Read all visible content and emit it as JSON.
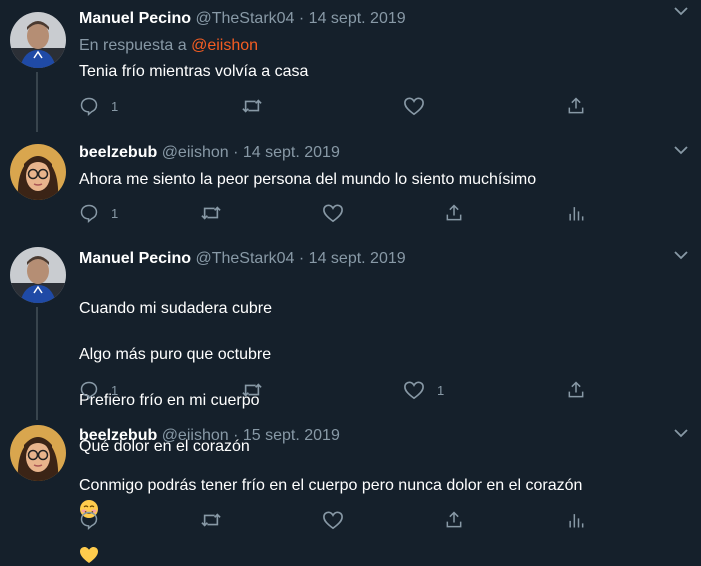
{
  "tweets": [
    {
      "name": "Manuel Pecino",
      "handle": "@TheStark04",
      "date": "14 sept. 2019",
      "reply_prefix": "En respuesta a",
      "reply_handle": "@eiishon",
      "text": "Tenia frío mientras volvía a casa",
      "reply_count": "1"
    },
    {
      "name": "beelzebub",
      "handle": "@eiishon",
      "date": "14 sept. 2019",
      "text": "Ahora me siento la peor persona del mundo lo siento muchísimo",
      "reply_count": "1"
    },
    {
      "name": "Manuel Pecino",
      "handle": "@TheStark04",
      "date": "14 sept. 2019",
      "lines": [
        "Cuando mi sudadera cubre",
        "Algo más puro que octubre",
        "Prefiero frío en mi cuerpo",
        "Qué dolor en el corazón"
      ],
      "reply_count": "1",
      "like_count": "1"
    },
    {
      "name": "beelzebub",
      "handle": "@eiishon",
      "date": "15 sept. 2019",
      "text": "Conmigo podrás tener frío en el cuerpo pero nunca dolor en el corazón",
      "emojis": [
        "smiling-face-emoji",
        "yellow-heart-emoji"
      ]
    }
  ],
  "separator": "·",
  "colors": {
    "background": "#15202b",
    "secondary_text": "#8899a6",
    "reply_handle": "#f45d22",
    "thread_line": "#38444d"
  }
}
